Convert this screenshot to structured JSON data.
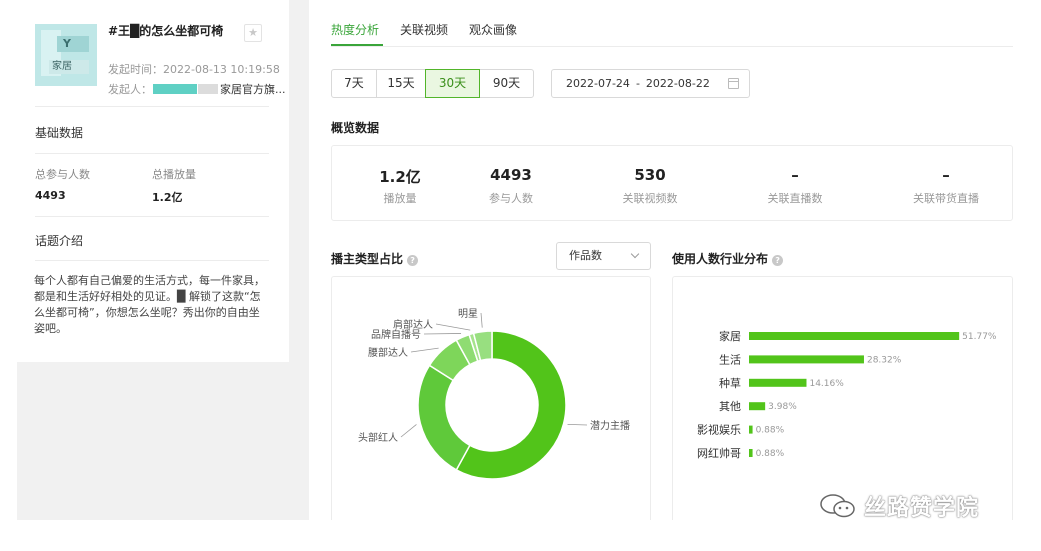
{
  "topic": {
    "title": "#王█的怎么坐都可椅",
    "thumb_tag": "Y",
    "thumb_caption": "家居",
    "publish_time_label": "发起时间：",
    "publish_time": "2022-08-13 10:19:58",
    "publisher_label": "发起人：",
    "publisher_name": "家居官方旗...",
    "star_icon": "star-icon"
  },
  "basic": {
    "heading": "基础数据",
    "total_participants_label": "总参与人数",
    "total_participants": "4493",
    "total_plays_label": "总播放量",
    "total_plays": "1.2亿"
  },
  "intro": {
    "heading": "话题介绍",
    "text": "每个人都有自己偏爱的生活方式，每一件家具，都是和生活好好相处的见证。█ 解锁了这款“怎么坐都可椅”，你想怎么坐呢？秀出你的自由坐姿吧。"
  },
  "tabs": [
    {
      "label": "热度分析",
      "active": true
    },
    {
      "label": "关联视频",
      "active": false
    },
    {
      "label": "观众画像",
      "active": false
    }
  ],
  "range": {
    "options": [
      "7天",
      "15天",
      "30天",
      "90天"
    ],
    "selected": "30天",
    "start": "2022-07-24",
    "sep": "-",
    "end": "2022-08-22"
  },
  "overview": {
    "heading": "概览数据",
    "items": [
      {
        "value": "1.2亿",
        "label": "播放量"
      },
      {
        "value": "4493",
        "label": "参与人数"
      },
      {
        "value": "530",
        "label": "关联视频数"
      },
      {
        "value": "–",
        "label": "关联直播数"
      },
      {
        "value": "–",
        "label": "关联带货直播"
      }
    ]
  },
  "creator_section": {
    "heading": "播主类型占比",
    "select_value": "作品数"
  },
  "industry_section": {
    "heading": "使用人数行业分布"
  },
  "watermark": {
    "text": "丝路赞学院"
  },
  "colors": {
    "accent": "#3aa53a",
    "bar": "#52c41a"
  },
  "chart_data": [
    {
      "type": "pie",
      "title": "播主类型占比",
      "slices": [
        {
          "name": "潜力主播",
          "value": 58
        },
        {
          "name": "头部红人",
          "value": 26
        },
        {
          "name": "腰部达人",
          "value": 8
        },
        {
          "name": "品牌自播号",
          "value": 3
        },
        {
          "name": "肩部达人",
          "value": 1
        },
        {
          "name": "明星",
          "value": 4
        }
      ],
      "colors": [
        "#52c41a",
        "#5fc93a",
        "#7ed65a",
        "#8fdc72",
        "#a6e38c",
        "#98df80"
      ]
    },
    {
      "type": "bar",
      "title": "使用人数行业分布",
      "orientation": "horizontal",
      "categories": [
        "家居",
        "生活",
        "种草",
        "其他",
        "影视娱乐",
        "网红帅哥"
      ],
      "values": [
        51.77,
        28.32,
        14.16,
        3.98,
        0.88,
        0.88
      ],
      "value_labels": [
        "51.77%",
        "28.32%",
        "14.16%",
        "3.98%",
        "0.88%",
        "0.88%"
      ],
      "xlim": [
        0,
        55
      ]
    }
  ]
}
